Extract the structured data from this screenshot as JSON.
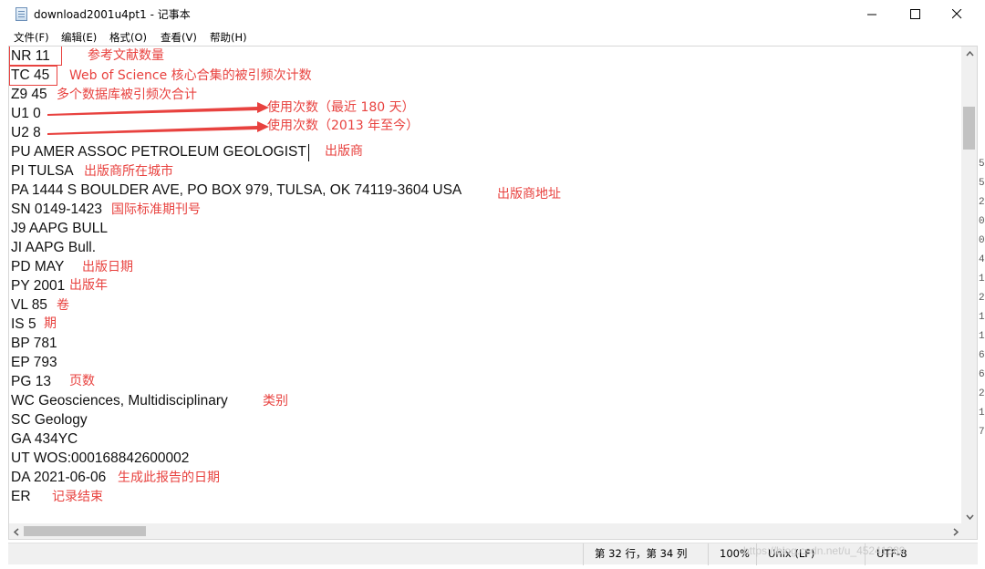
{
  "window": {
    "title": "download2001u4pt1 - 记事本",
    "icon": "notepad-icon"
  },
  "menu": {
    "file": "文件(F)",
    "edit": "编辑(E)",
    "format": "格式(O)",
    "view": "查看(V)",
    "help": "帮助(H)"
  },
  "document": {
    "lines": [
      "NR 11",
      "TC 45",
      "Z9 45",
      "U1 0",
      "U2 8",
      "PU AMER ASSOC PETROLEUM GEOLOGIST",
      "PI TULSA",
      "PA 1444 S BOULDER AVE, PO BOX 979, TULSA, OK 74119-3604 USA",
      "SN 0149-1423",
      "J9 AAPG BULL",
      "JI AAPG Bull.",
      "PD MAY",
      "PY 2001",
      "VL 85",
      "IS 5",
      "BP 781",
      "EP 793",
      "PG 13",
      "WC Geosciences, Multidisciplinary",
      "SC Geology",
      "GA 434YC",
      "UT WOS:000168842600002",
      "DA 2021-06-06",
      "ER"
    ]
  },
  "annotations": {
    "nr": "参考文献数量",
    "tc": "Web of Science 核心合集的被引频次计数",
    "z9": "多个数据库被引频次合计",
    "u1": "使用次数（最近 180 天）",
    "u2": "使用次数（2013 年至今）",
    "pu": "出版商",
    "pi": "出版商所在城市",
    "pa": "出版商地址",
    "sn": "国际标准期刊号",
    "pd": "出版日期",
    "py": "出版年",
    "vl": "卷",
    "is": "期",
    "pg": "页数",
    "wc": "类别",
    "da": "生成此报告的日期",
    "er": "记录结束",
    "color": "#e8423f"
  },
  "status": {
    "position": "第 32 行，第 34 列",
    "zoom": "100%",
    "line_ending": "Unix (LF)",
    "encoding": "UTF-8"
  },
  "watermark": "https://blog.csdn.net/u_45241389",
  "edge_digits": [
    "5",
    "5",
    "2",
    "0",
    "0",
    "4",
    "1",
    "2",
    "1",
    "1",
    "6",
    "6",
    "2",
    "1",
    "7"
  ]
}
